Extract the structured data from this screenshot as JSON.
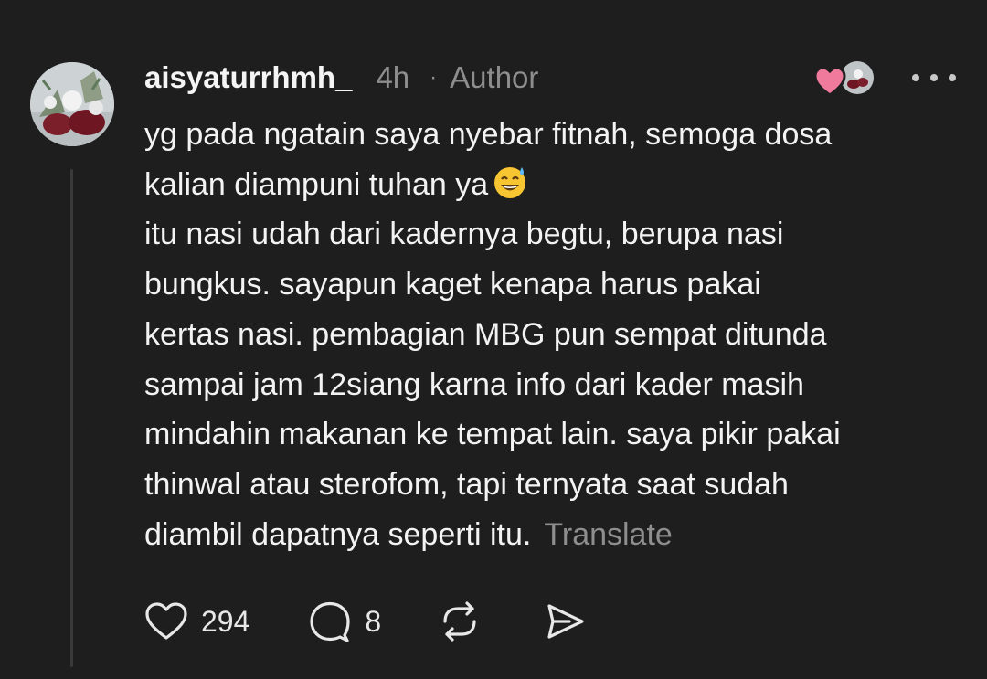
{
  "post": {
    "username": "aisyaturrhmh_",
    "time": "4h",
    "separator": "·",
    "author_badge": "Author",
    "lines": [
      "yg pada ngatain saya nyebar fitnah, semoga dosa",
      "kalian diampuni tuhan ya",
      "itu nasi udah dari kadernya begtu, berupa nasi",
      "bungkus. sayapun kaget kenapa harus pakai",
      "kertas nasi. pembagian MBG pun sempat ditunda",
      "sampai jam 12siang karna info dari kader masih",
      "mindahin makanan ke tempat lain. saya pikir pakai",
      "thinwal atau sterofom, tapi ternyata saat sudah",
      "diambil dapatnya seperti itu."
    ],
    "translate_label": "Translate"
  },
  "actions": {
    "likes": "294",
    "replies": "8"
  },
  "icons": [
    "avatar",
    "liked-by-author-heart-icon",
    "more-icon",
    "sweat-smile-emoji",
    "heart-icon",
    "comment-icon",
    "repost-icon",
    "share-icon"
  ],
  "colors": {
    "background": "#1e1e1e",
    "text": "#f3f3f3",
    "muted": "#8e8e8e",
    "heart_badge": "#f07a9b"
  }
}
